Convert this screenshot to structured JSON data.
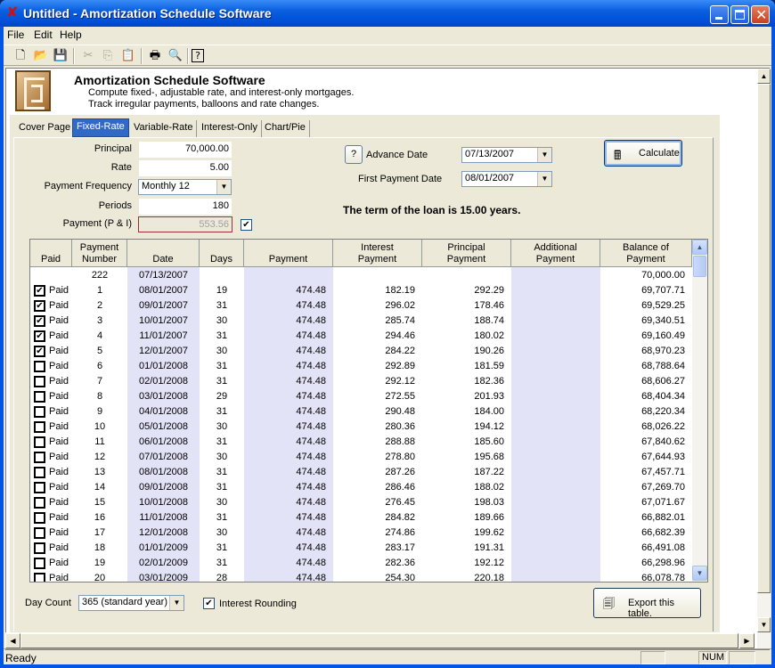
{
  "window": {
    "title": "Untitled - Amortization Schedule Software",
    "app_icon": "red-x-app-icon",
    "controls": [
      "minimize",
      "maximize",
      "close"
    ]
  },
  "menu": [
    "File",
    "Edit",
    "Help"
  ],
  "toolbar": {
    "items": [
      {
        "name": "new-icon",
        "glyph": "🗋",
        "enabled": true
      },
      {
        "name": "open-icon",
        "glyph": "📂",
        "enabled": true
      },
      {
        "name": "save-icon",
        "glyph": "💾",
        "enabled": true
      },
      {
        "name": "cut-icon",
        "glyph": "✂",
        "enabled": false
      },
      {
        "name": "copy-icon",
        "glyph": "⎘",
        "enabled": false
      },
      {
        "name": "paste-icon",
        "glyph": "📋",
        "enabled": false
      },
      {
        "name": "print-icon",
        "glyph": "🖶",
        "enabled": true
      },
      {
        "name": "print-preview-icon",
        "glyph": "🔍",
        "enabled": true
      },
      {
        "name": "help-icon",
        "glyph": "?",
        "enabled": true
      }
    ]
  },
  "header": {
    "app_name": "Amortization Schedule Software",
    "desc_line1": "Compute fixed-, adjustable rate, and interest-only mortgages.",
    "desc_line2": "Track irregular payments, balloons and rate changes."
  },
  "tabs": [
    {
      "label": "Cover Page",
      "active": false
    },
    {
      "label": "Fixed-Rate",
      "active": true
    },
    {
      "label": "Variable-Rate",
      "active": false
    },
    {
      "label": "Interest-Only",
      "active": false
    },
    {
      "label": "Chart/Pie",
      "active": false
    }
  ],
  "form": {
    "principal_label": "Principal",
    "principal_value": "70,000.00",
    "rate_label": "Rate",
    "rate_value": "5.00",
    "frequency_label": "Payment Frequency",
    "frequency_value": "Monthly 12",
    "periods_label": "Periods",
    "periods_value": "180",
    "payment_label": "Payment (P & I)",
    "payment_value": "553.56",
    "payment_override_checked": true,
    "help_button": "?",
    "advance_date_label": "Advance Date",
    "advance_date_value": "07/13/2007",
    "first_payment_label": "First Payment Date",
    "first_payment_value": "08/01/2007",
    "calculate_label": "Calculate",
    "term_text": "The term of the loan is 15.00 years."
  },
  "table": {
    "columns": [
      {
        "l1": "",
        "l2": "Paid"
      },
      {
        "l1": "Payment",
        "l2": "Number"
      },
      {
        "l1": "",
        "l2": "Date"
      },
      {
        "l1": "",
        "l2": "Days"
      },
      {
        "l1": "",
        "l2": "Payment"
      },
      {
        "l1": "Interest",
        "l2": "Payment"
      },
      {
        "l1": "Principal",
        "l2": "Payment"
      },
      {
        "l1": "Additional",
        "l2": "Payment"
      },
      {
        "l1": "Balance of",
        "l2": "Payment"
      }
    ],
    "initial_row": {
      "number": "222",
      "date": "07/13/2007",
      "balance": "70,000.00"
    },
    "paid_label": "Paid",
    "rows": [
      {
        "paid": true,
        "n": "1",
        "date": "08/01/2007",
        "days": "19",
        "pay": "474.48",
        "int": "182.19",
        "prin": "292.29",
        "add": "",
        "bal": "69,707.71"
      },
      {
        "paid": true,
        "n": "2",
        "date": "09/01/2007",
        "days": "31",
        "pay": "474.48",
        "int": "296.02",
        "prin": "178.46",
        "add": "",
        "bal": "69,529.25"
      },
      {
        "paid": true,
        "n": "3",
        "date": "10/01/2007",
        "days": "30",
        "pay": "474.48",
        "int": "285.74",
        "prin": "188.74",
        "add": "",
        "bal": "69,340.51"
      },
      {
        "paid": true,
        "n": "4",
        "date": "11/01/2007",
        "days": "31",
        "pay": "474.48",
        "int": "294.46",
        "prin": "180.02",
        "add": "",
        "bal": "69,160.49"
      },
      {
        "paid": true,
        "n": "5",
        "date": "12/01/2007",
        "days": "30",
        "pay": "474.48",
        "int": "284.22",
        "prin": "190.26",
        "add": "",
        "bal": "68,970.23"
      },
      {
        "paid": false,
        "n": "6",
        "date": "01/01/2008",
        "days": "31",
        "pay": "474.48",
        "int": "292.89",
        "prin": "181.59",
        "add": "",
        "bal": "68,788.64"
      },
      {
        "paid": false,
        "n": "7",
        "date": "02/01/2008",
        "days": "31",
        "pay": "474.48",
        "int": "292.12",
        "prin": "182.36",
        "add": "",
        "bal": "68,606.27"
      },
      {
        "paid": false,
        "n": "8",
        "date": "03/01/2008",
        "days": "29",
        "pay": "474.48",
        "int": "272.55",
        "prin": "201.93",
        "add": "",
        "bal": "68,404.34"
      },
      {
        "paid": false,
        "n": "9",
        "date": "04/01/2008",
        "days": "31",
        "pay": "474.48",
        "int": "290.48",
        "prin": "184.00",
        "add": "",
        "bal": "68,220.34"
      },
      {
        "paid": false,
        "n": "10",
        "date": "05/01/2008",
        "days": "30",
        "pay": "474.48",
        "int": "280.36",
        "prin": "194.12",
        "add": "",
        "bal": "68,026.22"
      },
      {
        "paid": false,
        "n": "11",
        "date": "06/01/2008",
        "days": "31",
        "pay": "474.48",
        "int": "288.88",
        "prin": "185.60",
        "add": "",
        "bal": "67,840.62"
      },
      {
        "paid": false,
        "n": "12",
        "date": "07/01/2008",
        "days": "30",
        "pay": "474.48",
        "int": "278.80",
        "prin": "195.68",
        "add": "",
        "bal": "67,644.93"
      },
      {
        "paid": false,
        "n": "13",
        "date": "08/01/2008",
        "days": "31",
        "pay": "474.48",
        "int": "287.26",
        "prin": "187.22",
        "add": "",
        "bal": "67,457.71"
      },
      {
        "paid": false,
        "n": "14",
        "date": "09/01/2008",
        "days": "31",
        "pay": "474.48",
        "int": "286.46",
        "prin": "188.02",
        "add": "",
        "bal": "67,269.70"
      },
      {
        "paid": false,
        "n": "15",
        "date": "10/01/2008",
        "days": "30",
        "pay": "474.48",
        "int": "276.45",
        "prin": "198.03",
        "add": "",
        "bal": "67,071.67"
      },
      {
        "paid": false,
        "n": "16",
        "date": "11/01/2008",
        "days": "31",
        "pay": "474.48",
        "int": "284.82",
        "prin": "189.66",
        "add": "",
        "bal": "66,882.01"
      },
      {
        "paid": false,
        "n": "17",
        "date": "12/01/2008",
        "days": "30",
        "pay": "474.48",
        "int": "274.86",
        "prin": "199.62",
        "add": "",
        "bal": "66,682.39"
      },
      {
        "paid": false,
        "n": "18",
        "date": "01/01/2009",
        "days": "31",
        "pay": "474.48",
        "int": "283.17",
        "prin": "191.31",
        "add": "",
        "bal": "66,491.08"
      },
      {
        "paid": false,
        "n": "19",
        "date": "02/01/2009",
        "days": "31",
        "pay": "474.48",
        "int": "282.36",
        "prin": "192.12",
        "add": "",
        "bal": "66,298.96"
      },
      {
        "paid": false,
        "n": "20",
        "date": "03/01/2009",
        "days": "28",
        "pay": "474.48",
        "int": "254.30",
        "prin": "220.18",
        "add": "",
        "bal": "66,078.78"
      }
    ]
  },
  "footer": {
    "day_count_label": "Day Count",
    "day_count_value": "365 (standard year)",
    "interest_rounding_label": "Interest Rounding",
    "interest_rounding_checked": true,
    "export_label": "Export this table."
  },
  "statusbar": {
    "text": "Ready",
    "num": "NUM"
  },
  "colors": {
    "titlebar": "#0055e5",
    "active_tab": "#316ac5",
    "column_tint": "#e3e3f8",
    "face": "#ece9d8"
  }
}
